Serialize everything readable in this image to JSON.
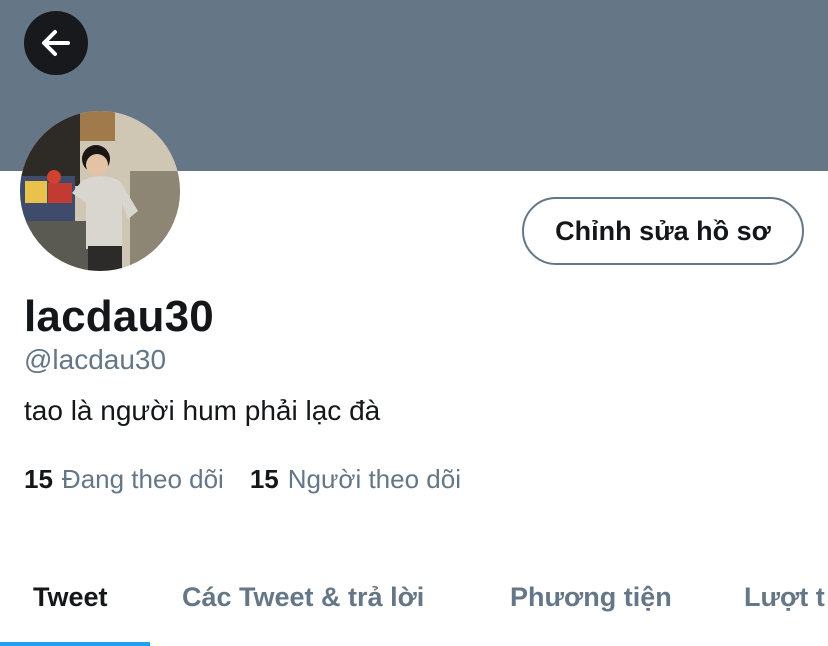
{
  "profile": {
    "display_name": "lacdau30",
    "handle": "@lacdau30",
    "bio": "tao là người hum phải lạc đà",
    "edit_button_label": "Chỉnh sửa hồ sơ",
    "following_count": "15",
    "following_label": "Đang theo dõi",
    "followers_count": "15",
    "followers_label": "Người theo dõi"
  },
  "tabs": [
    {
      "label": "Tweet",
      "active": true
    },
    {
      "label": "Các Tweet & trả lời",
      "active": false
    },
    {
      "label": "Phương tiện",
      "active": false
    },
    {
      "label": "Lượt t",
      "active": false
    }
  ],
  "icons": {
    "back": "arrow-left-icon"
  },
  "colors": {
    "banner": "#657786",
    "accent": "#1da1f2",
    "secondary_text": "#657786",
    "primary_text": "#14171a"
  }
}
